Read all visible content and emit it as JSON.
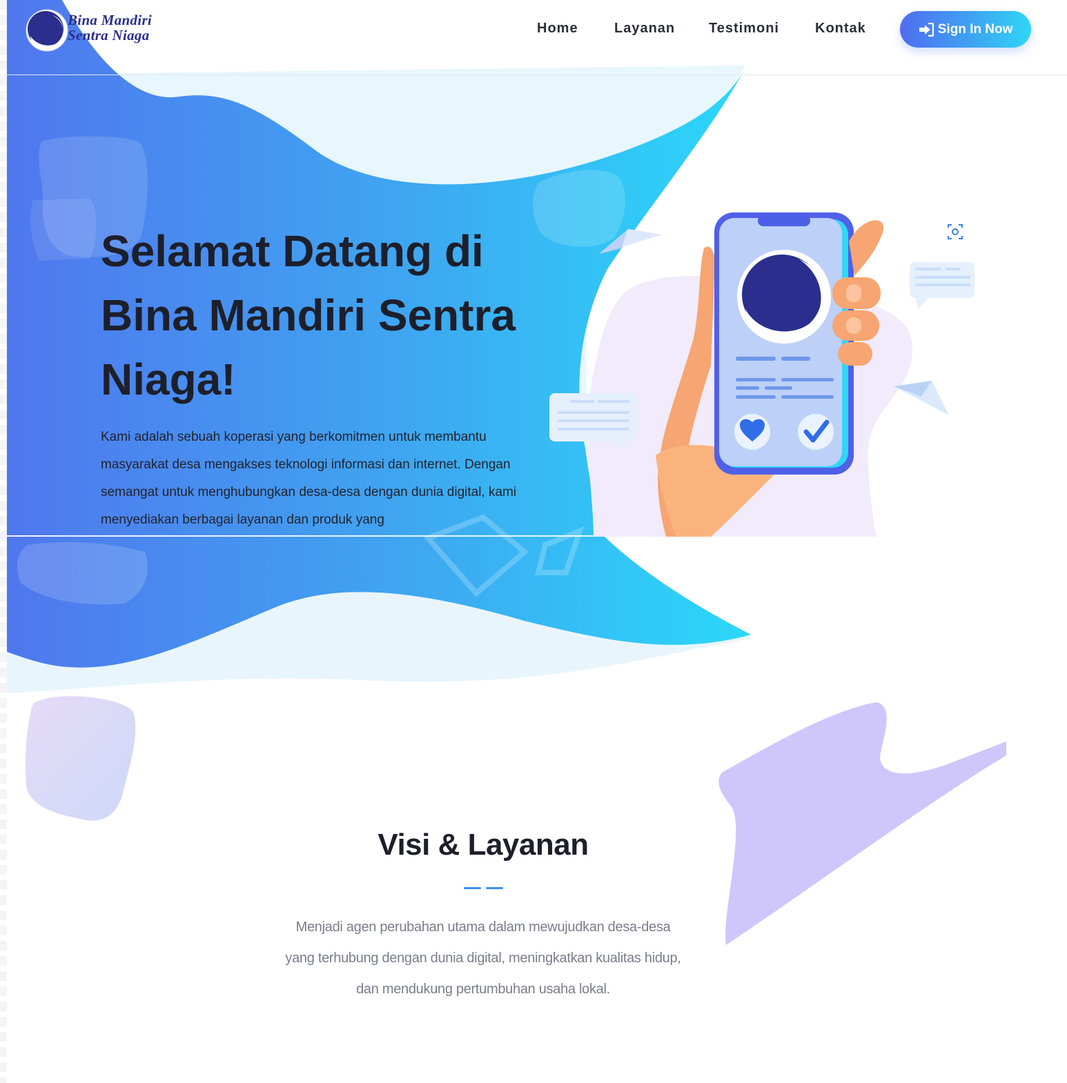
{
  "brand": {
    "name_line1": "Bina Mandiri",
    "name_line2": "Sentra Niaga",
    "logo_icon": "crescent-moon-logo"
  },
  "nav": {
    "items": [
      {
        "label": "Home"
      },
      {
        "label": "Layanan"
      },
      {
        "label": "Testimoni"
      },
      {
        "label": "Kontak"
      }
    ],
    "signin_label": "Sign In Now",
    "signin_icon": "sign-in-icon"
  },
  "hero": {
    "title": "Selamat Datang di Bina Mandiri Sentra Niaga!",
    "description": "Kami adalah sebuah koperasi yang berkomitmen untuk membantu masyarakat desa mengakses teknologi informasi dan internet. Dengan semangat untuk menghubungkan desa-desa dengan dunia digital, kami menyediakan berbagai layanan dan produk yang"
  },
  "vision": {
    "title": "Visi & Layanan",
    "description": "Menjadi agen perubahan utama dalam mewujudkan desa-desa yang terhubung dengan dunia digital, meningkatkan kualitas hidup, dan mendukung pertumbuhan usaha lokal."
  },
  "colors": {
    "gradient_start": "#4f73ee",
    "gradient_end": "#2fd6f8",
    "title_dark": "#1d1f2b",
    "accent_purple": "#cfc6fb",
    "logo_navy": "#2b2e8c"
  }
}
